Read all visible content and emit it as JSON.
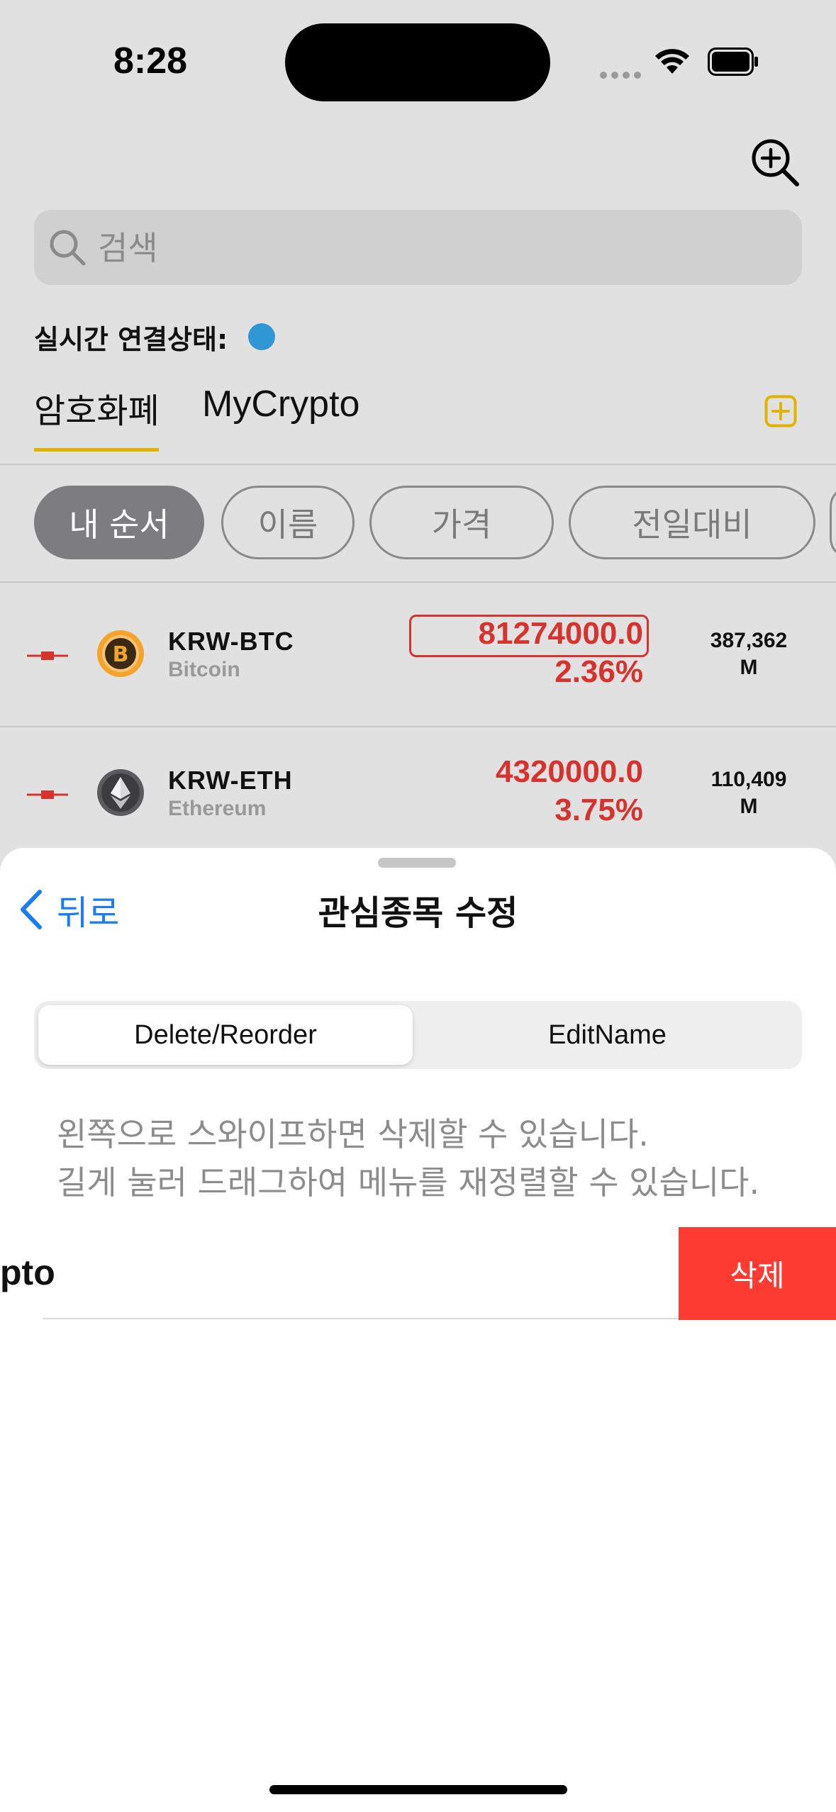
{
  "status_bar": {
    "time": "8:28"
  },
  "search": {
    "placeholder": "검색"
  },
  "connection": {
    "label": "실시간 연결상태:",
    "color": "#2e97d4"
  },
  "tabs": [
    {
      "label": "암호화폐",
      "active": true
    },
    {
      "label": "MyCrypto",
      "active": false
    }
  ],
  "sort_chips": [
    {
      "label": "내 순서",
      "active": true
    },
    {
      "label": "이름",
      "active": false
    },
    {
      "label": "가격",
      "active": false
    },
    {
      "label": "전일대비",
      "active": false
    }
  ],
  "coins": [
    {
      "ticker": "KRW-BTC",
      "name": "Bitcoin",
      "price": "81274000.0",
      "change": "2.36%",
      "volume_num": "387,362",
      "volume_unit": "M",
      "icon": "bitcoin-icon"
    },
    {
      "ticker": "KRW-ETH",
      "name": "Ethereum",
      "price": "4320000.0",
      "change": "3.75%",
      "volume_num": "110,409",
      "volume_unit": "M",
      "icon": "ethereum-icon"
    }
  ],
  "sheet": {
    "back_label": "뒤로",
    "title": "관심종목 수정",
    "segments": [
      {
        "label": "Delete/Reorder",
        "selected": true
      },
      {
        "label": "EditName",
        "selected": false
      }
    ],
    "hint_line1": "왼쪽으로 스와이프하면 삭제할 수 있습니다.",
    "hint_line2": "길게 눌러 드래그하여 메뉴를 재정렬할 수 있습니다.",
    "list_item_label": "pto",
    "delete_label": "삭제"
  },
  "colors": {
    "accent_yellow": "#e0b300",
    "price_red": "#d6322e",
    "ios_blue": "#1b7cf0",
    "destructive": "#fe3b30"
  }
}
